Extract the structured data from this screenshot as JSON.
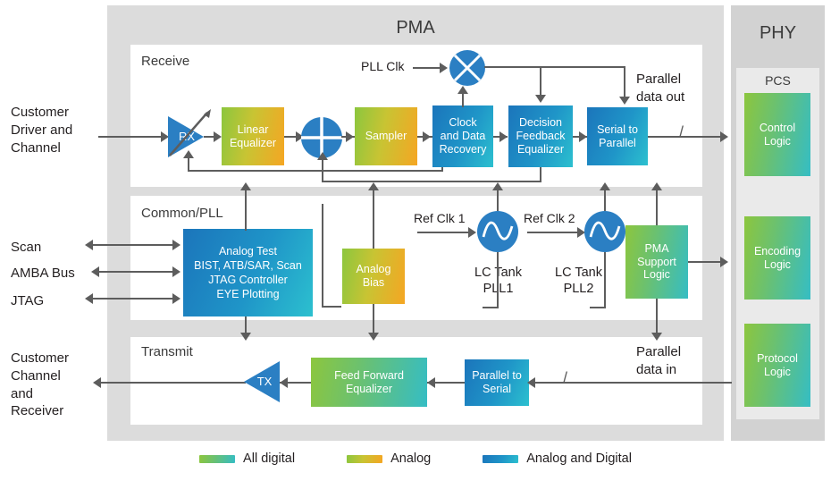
{
  "diagram": {
    "pma_title": "PMA",
    "phy_title": "PHY",
    "pcs_title": "PCS",
    "rows": {
      "receive": "Receive",
      "common": "Common/PLL",
      "transmit": "Transmit"
    }
  },
  "side_labels": {
    "customer_driver": "Customer\nDriver and\nChannel",
    "scan": "Scan",
    "amba": "AMBA Bus",
    "jtag": "JTAG",
    "customer_channel": "Customer\nChannel\nand\nReceiver"
  },
  "receive": {
    "rx_amp": "RX",
    "linear_equalizer": "Linear\nEqualizer",
    "sampler": "Sampler",
    "cdr": "Clock\nand Data\nRecovery",
    "dfe": "Decision\nFeedback\nEqualizer",
    "serial_to_parallel": "Serial to\nParallel",
    "pll_clk": "PLL Clk",
    "parallel_data_out": "Parallel\ndata out",
    "bus_marker": "/"
  },
  "common": {
    "analog_test": "Analog Test\nBIST, ATB/SAR, Scan\nJTAG Controller\nEYE Plotting",
    "analog_bias": "Analog\nBias",
    "ref_clk_1": "Ref Clk 1",
    "ref_clk_2": "Ref Clk 2",
    "lc_tank_pll1": "LC Tank\nPLL1",
    "lc_tank_pll2": "LC Tank\nPLL2",
    "pma_support": "PMA\nSupport\nLogic"
  },
  "transmit": {
    "tx_amp": "TX",
    "feed_forward_equalizer": "Feed Forward\nEqualizer",
    "parallel_to_serial": "Parallel to\nSerial",
    "parallel_data_in": "Parallel\ndata in",
    "bus_marker": "/"
  },
  "pcs": {
    "control_logic": "Control\nLogic",
    "encoding_logic": "Encoding\nLogic",
    "protocol_logic": "Protocol\nLogic"
  },
  "legend": {
    "items": [
      {
        "label": "All digital",
        "class": "g-digital"
      },
      {
        "label": "Analog",
        "class": "g-analog"
      },
      {
        "label": "Analog and Digital",
        "class": "g-both"
      }
    ]
  },
  "colors": {
    "digital_start": "#8cc63e",
    "digital_end": "#35bdc4",
    "analog_start": "#8cc63e",
    "analog_end": "#f5a623",
    "both_start": "#1b75bb",
    "both_end": "#2cc0cf",
    "line": "#5d5d5d",
    "panel": "#dcdcdc",
    "phy_panel": "#d2d2d2",
    "row_bg": "#ffffff",
    "accent_blue": "#2b7fc3"
  }
}
